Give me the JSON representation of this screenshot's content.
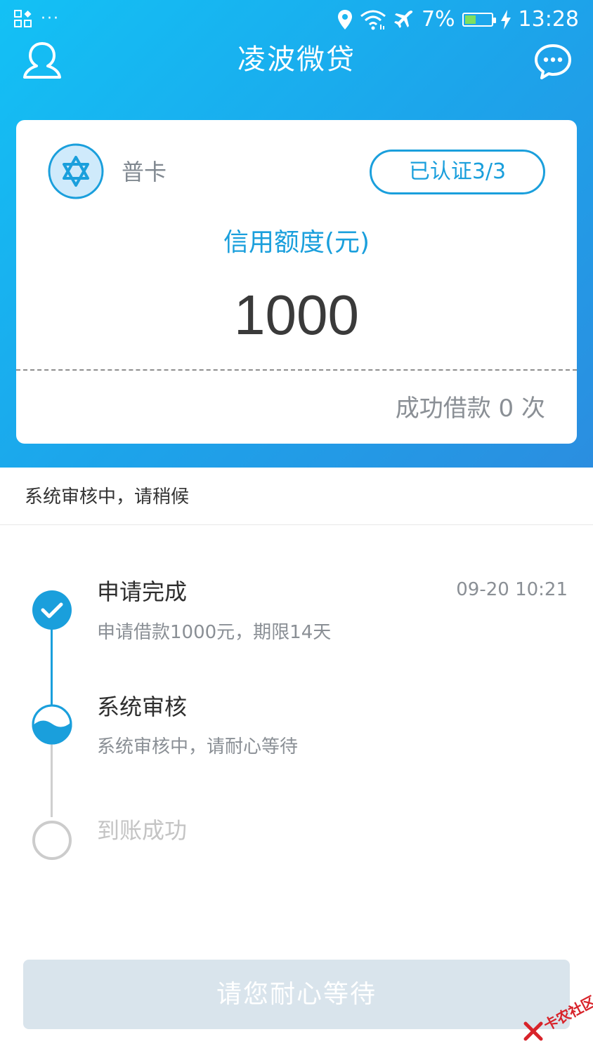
{
  "statusbar": {
    "dots": "···",
    "battery_percent_text": "7%",
    "battery_level": 0.07,
    "time": "13:28"
  },
  "nav": {
    "title": "凌波微贷"
  },
  "card": {
    "badge_label": "普卡",
    "cert_label": "已认证3/3",
    "credit_label": "信用额度(元)",
    "credit_amount": "1000",
    "loan_count": "成功借款 0 次"
  },
  "notice": {
    "text": "系统审核中，请稍候"
  },
  "timeline": {
    "steps": [
      {
        "title": "申请完成",
        "desc": "申请借款1000元，期限14天",
        "time": "09-20 10:21",
        "state": "done"
      },
      {
        "title": "系统审核",
        "desc": "系统审核中，请耐心等待",
        "state": "in-progress"
      },
      {
        "title": "到账成功",
        "state": "pending"
      }
    ]
  },
  "action": {
    "label": "请您耐心等待"
  },
  "watermark": {
    "text": "卡农社区"
  },
  "colors": {
    "accent": "#1a9fdc",
    "header_start": "#13c1f5",
    "header_end": "#2b8ee0",
    "button_disabled": "#d9e4ec",
    "muted_text": "#8a8f95"
  }
}
